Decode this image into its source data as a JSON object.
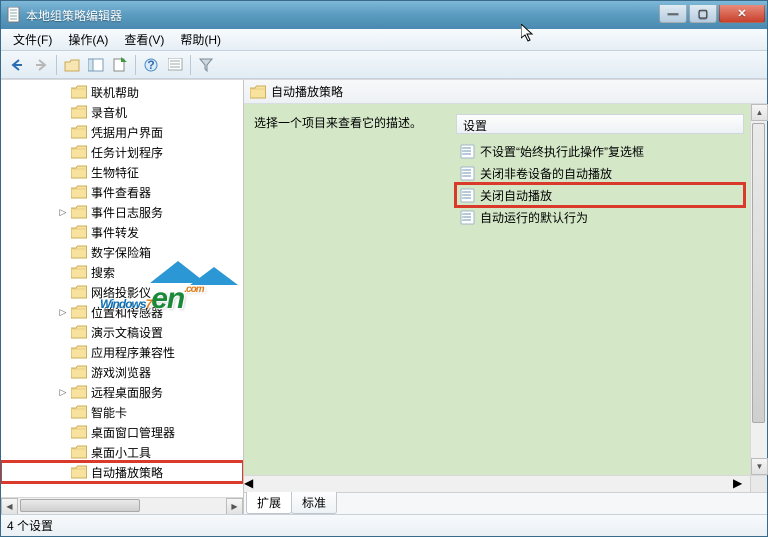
{
  "window": {
    "title": "本地组策略编辑器"
  },
  "menubar": [
    "文件(F)",
    "操作(A)",
    "查看(V)",
    "帮助(H)"
  ],
  "toolbar_icons": [
    "back-arrow-icon",
    "forward-arrow-icon",
    "up-folder-icon",
    "show-tree-icon",
    "export-icon",
    "help-icon",
    "properties-icon",
    "filter-icon"
  ],
  "tree": [
    {
      "label": "联机帮助",
      "expander": ""
    },
    {
      "label": "录音机",
      "expander": ""
    },
    {
      "label": "凭据用户界面",
      "expander": ""
    },
    {
      "label": "任务计划程序",
      "expander": ""
    },
    {
      "label": "生物特征",
      "expander": ""
    },
    {
      "label": "事件查看器",
      "expander": ""
    },
    {
      "label": "事件日志服务",
      "expander": "▷"
    },
    {
      "label": "事件转发",
      "expander": ""
    },
    {
      "label": "数字保险箱",
      "expander": ""
    },
    {
      "label": "搜索",
      "expander": ""
    },
    {
      "label": "网络投影仪",
      "expander": ""
    },
    {
      "label": "位置和传感器",
      "expander": "▷"
    },
    {
      "label": "演示文稿设置",
      "expander": ""
    },
    {
      "label": "应用程序兼容性",
      "expander": ""
    },
    {
      "label": "游戏浏览器",
      "expander": ""
    },
    {
      "label": "远程桌面服务",
      "expander": "▷"
    },
    {
      "label": "智能卡",
      "expander": ""
    },
    {
      "label": "桌面窗口管理器",
      "expander": ""
    },
    {
      "label": "桌面小工具",
      "expander": ""
    },
    {
      "label": "自动播放策略",
      "expander": "",
      "highlight": true
    }
  ],
  "right": {
    "header": "自动播放策略",
    "description": "选择一个项目来查看它的描述。",
    "column_header": "设置",
    "items": [
      {
        "label": "不设置“始终执行此操作”复选框"
      },
      {
        "label": "关闭非卷设备的自动播放"
      },
      {
        "label": "关闭自动播放",
        "highlight": true
      },
      {
        "label": "自动运行的默认行为"
      }
    ],
    "tabs": [
      "扩展",
      "标准"
    ],
    "active_tab": 0
  },
  "statusbar": "4 个设置",
  "watermark": {
    "text_a": "Windows",
    "text_b": "7",
    "text_c": "en",
    "text_d": ".com"
  }
}
